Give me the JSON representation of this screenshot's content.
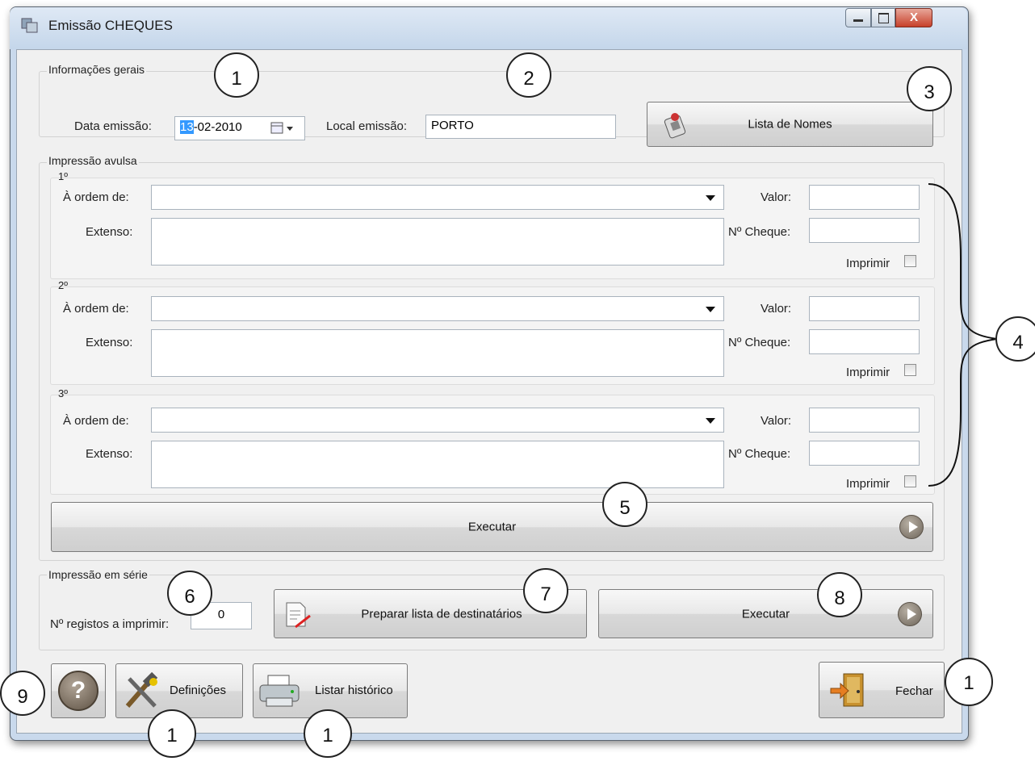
{
  "window": {
    "title": "Emissão CHEQUES",
    "close_glyph": "X"
  },
  "gerais": {
    "legend": "Informações gerais",
    "date_label": "Data emissão:",
    "date_day": "13",
    "date_rest": "-02-2010",
    "local_label": "Local emissão:",
    "local_value": "PORTO",
    "lista_button": "Lista de Nomes"
  },
  "avulsa": {
    "legend": "Impressão avulsa",
    "entries": [
      {
        "index": "1º",
        "ordem_label": "À ordem de:",
        "extenso_label": "Extenso:",
        "valor_label": "Valor:",
        "cheque_label": "Nº Cheque:",
        "imprimir_label": "Imprimir"
      },
      {
        "index": "2º",
        "ordem_label": "À ordem de:",
        "extenso_label": "Extenso:",
        "valor_label": "Valor:",
        "cheque_label": "Nº Cheque:",
        "imprimir_label": "Imprimir"
      },
      {
        "index": "3º",
        "ordem_label": "À ordem de:",
        "extenso_label": "Extenso:",
        "valor_label": "Valor:",
        "cheque_label": "Nº Cheque:",
        "imprimir_label": "Imprimir"
      }
    ],
    "executar": "Executar"
  },
  "serie": {
    "legend": "Impressão em série",
    "registos_label": "Nº registos a imprimir:",
    "registos_value": "0",
    "preparar_button": "Preparar lista de destinatários",
    "executar": "Executar"
  },
  "footer": {
    "definicoes": "Definições",
    "historico": "Listar histórico",
    "fechar": "Fechar"
  },
  "callouts": [
    "1",
    "2",
    "3",
    "4",
    "5",
    "6",
    "7",
    "8",
    "9",
    "1",
    "1",
    "1"
  ],
  "icons": [
    "app-icon",
    "calendar-icon",
    "list-names-icon",
    "play-arrow-icon",
    "document-edit-icon",
    "help-icon",
    "tools-icon",
    "printer-icon",
    "exit-door-icon"
  ]
}
